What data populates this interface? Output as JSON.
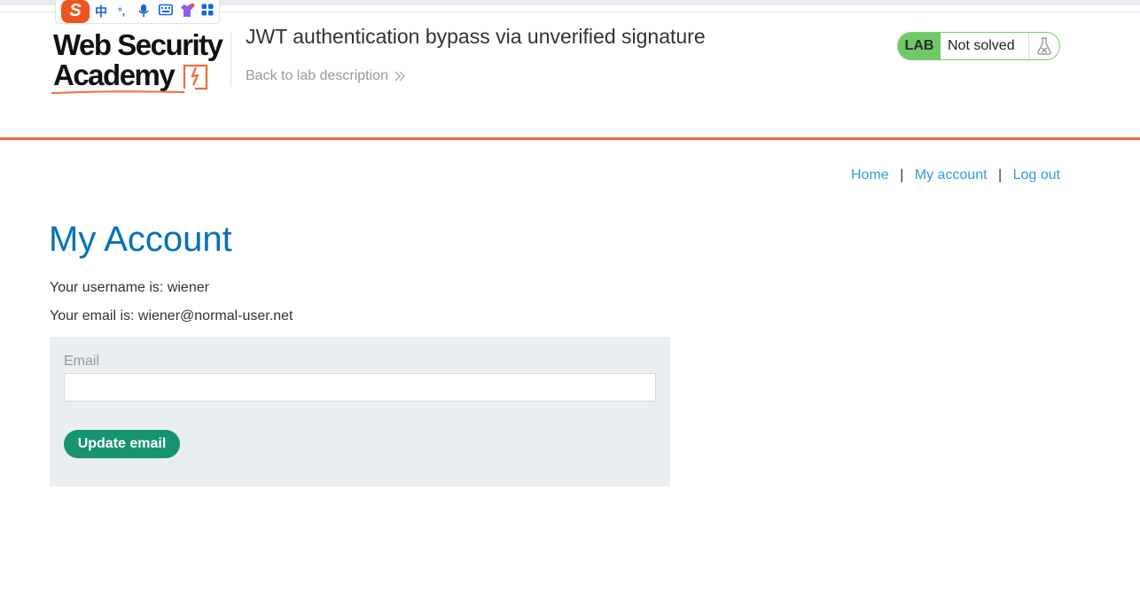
{
  "ime_toolbar": {
    "logo_char": "S",
    "lang_char": "中",
    "punct_char": "°,"
  },
  "header": {
    "logo_line1": "Web Security",
    "logo_line2": "Academy",
    "lab_title": "JWT authentication bypass via unverified signature",
    "back_link": "Back to lab description",
    "badge_lab": "LAB",
    "badge_status": "Not solved"
  },
  "nav": {
    "items": [
      {
        "label": "Home"
      },
      {
        "label": "My account"
      },
      {
        "label": "Log out"
      }
    ],
    "separator": "|"
  },
  "main": {
    "title": "My Account",
    "username_line": "Your username is: wiener",
    "email_line": "Your email is: wiener@normal-user.net"
  },
  "form": {
    "email_label": "Email",
    "email_value": "",
    "submit_label": "Update email"
  },
  "colors": {
    "accent_orange": "#f26b35",
    "title_blue": "#0071bc",
    "link_blue": "#2e9fd8",
    "badge_green": "#70c867",
    "button_green": "#17946e"
  }
}
